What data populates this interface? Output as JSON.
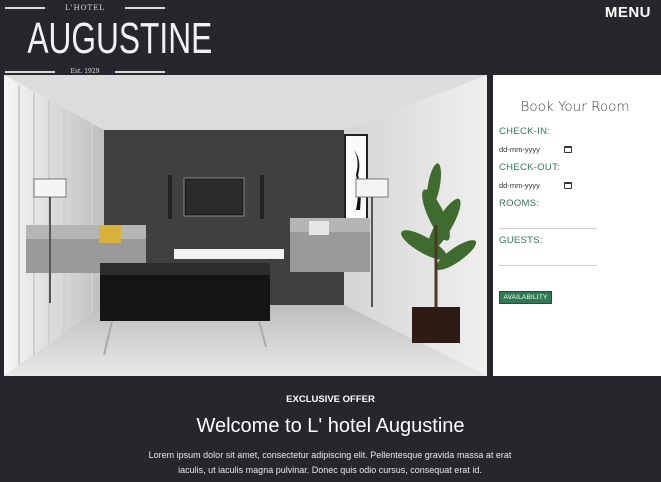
{
  "header": {
    "logo_small": "L'HOTEL",
    "logo_brand": "AUGUSTINE",
    "logo_est": "Est. 1929",
    "menu_label": "MENU"
  },
  "booking": {
    "title": "Book Your Room",
    "checkin_label": "CHECK-IN:",
    "checkin_placeholder": "dd-mm-yyyy",
    "checkout_label": "CHECK-OUT:",
    "checkout_placeholder": "dd-mm-yyyy",
    "rooms_label": "ROOMS:",
    "guests_label": "GUESTS:",
    "button_label": "AVAILABILITY"
  },
  "content": {
    "offer_label": "EXCLUSIVE OFFER",
    "welcome_title": "Welcome to L' hotel Augustine",
    "lorem_line1": "Lorem ipsum dolor sit amet, consectetur adipiscing elit. Pellentesque gravida massa at erat",
    "lorem_line2": "iaculis, ut iaculis magna pulvinar. Donec quis odio cursus, consequat erat id."
  },
  "colors": {
    "background": "#25272c",
    "accent_green": "#2f7a53"
  }
}
